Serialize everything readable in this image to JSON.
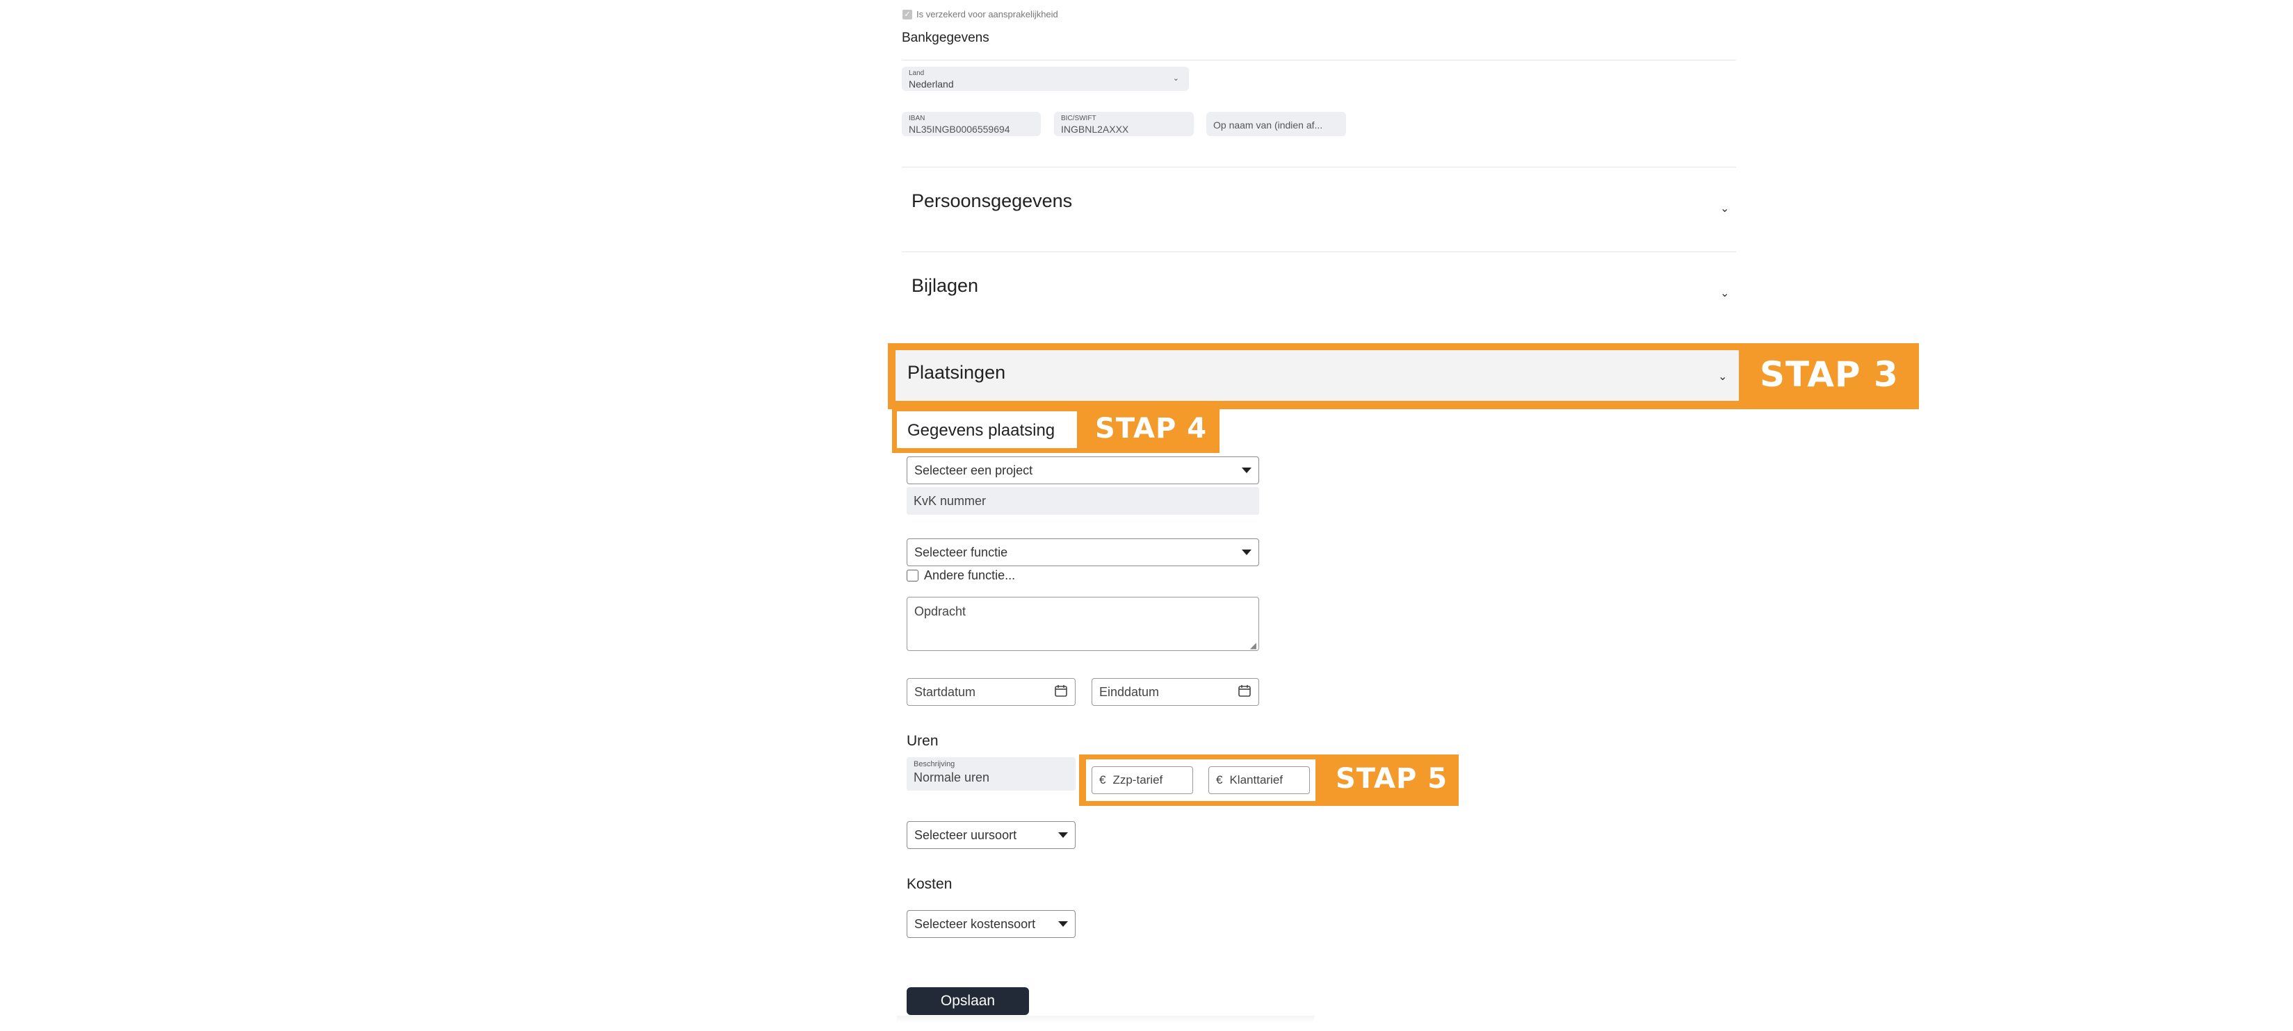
{
  "insured_checkbox": {
    "label": "Is verzekerd voor aansprakelijkheid",
    "checked": true
  },
  "bank": {
    "title": "Bankgegevens",
    "country_label": "Land",
    "country_value": "Nederland",
    "iban_label": "IBAN",
    "iban_value": "NL35INGB0006559694",
    "bic_label": "BIC/SWIFT",
    "bic_value": "INGBNL2AXXX",
    "account_name_placeholder": "Op naam van (indien af..."
  },
  "sections": {
    "personal": "Persoonsgegevens",
    "attachments": "Bijlagen",
    "placements": "Plaatsingen"
  },
  "steps": {
    "step3": "STAP 3",
    "step4": "STAP 4",
    "step5": "STAP 5"
  },
  "placement": {
    "subtitle": "Gegevens plaatsing",
    "project_select": "Selecteer een project",
    "kvk_placeholder": "KvK nummer",
    "function_select": "Selecteer functie",
    "other_function_label": "Andere functie...",
    "assignment_placeholder": "Opdracht",
    "start_date_placeholder": "Startdatum",
    "end_date_placeholder": "Einddatum"
  },
  "hours": {
    "title": "Uren",
    "description_label": "Beschrijving",
    "description_value": "Normale uren",
    "currency_symbol": "€",
    "zzp_rate_placeholder": "Zzp-tarief",
    "client_rate_placeholder": "Klanttarief",
    "hour_type_select": "Selecteer uursoort"
  },
  "costs": {
    "title": "Kosten",
    "cost_type_select": "Selecteer kostensoort"
  },
  "save_button": "Opslaan",
  "colors": {
    "highlight": "#f39a2b",
    "button_bg": "#212a36"
  },
  "icons": {
    "chevron": "chevron-down-icon",
    "calendar": "calendar-icon",
    "caret": "caret-down-icon"
  }
}
